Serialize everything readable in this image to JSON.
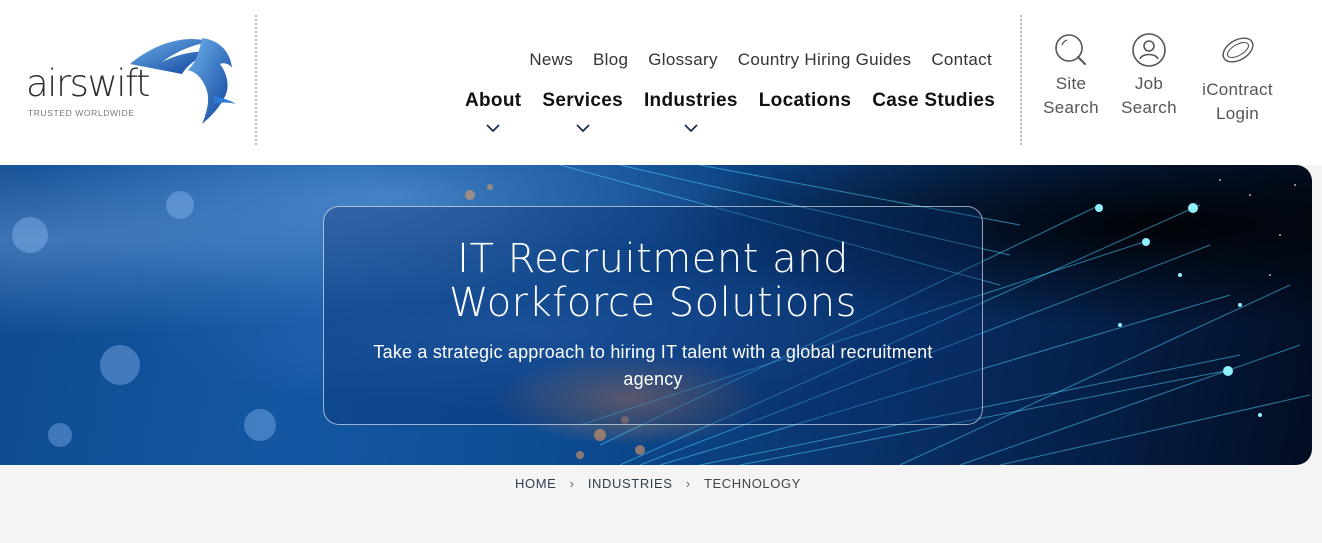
{
  "brand": {
    "name": "airswift",
    "tagline": "TRUSTED WORLDWIDE",
    "accent": "#1e6fd0"
  },
  "top_nav": [
    {
      "label": "News"
    },
    {
      "label": "Blog"
    },
    {
      "label": "Glossary"
    },
    {
      "label": "Country Hiring Guides"
    },
    {
      "label": "Contact"
    }
  ],
  "main_nav": [
    {
      "label": "About",
      "has_dropdown": true
    },
    {
      "label": "Services",
      "has_dropdown": true
    },
    {
      "label": "Industries",
      "has_dropdown": true
    },
    {
      "label": "Locations",
      "has_dropdown": false
    },
    {
      "label": "Case Studies",
      "has_dropdown": false
    }
  ],
  "tools": [
    {
      "line1": "Site",
      "line2": "Search",
      "icon": "search-icon"
    },
    {
      "line1": "Job",
      "line2": "Search",
      "icon": "user-icon"
    },
    {
      "line1": "iContract",
      "line2": "Login",
      "icon": "ring-icon"
    }
  ],
  "hero": {
    "title_line1": "IT Recruitment and",
    "title_line2": "Workforce Solutions",
    "subtitle": "Take a strategic approach to hiring IT talent with a global recruitment agency"
  },
  "breadcrumb": [
    {
      "label": "HOME"
    },
    {
      "label": "INDUSTRIES"
    },
    {
      "label": "TECHNOLOGY"
    }
  ],
  "breadcrumb_separator": "›"
}
